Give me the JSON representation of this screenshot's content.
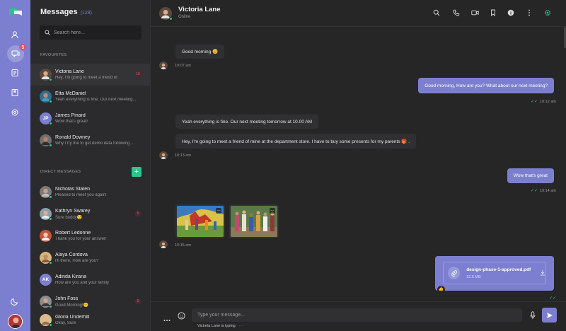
{
  "rail": {
    "nav": [
      "logo-icon",
      "user-icon",
      "chat-icon",
      "contacts-icon",
      "bookmark-icon",
      "settings-icon"
    ],
    "chat_badge": "9",
    "theme_icon": "moon-icon",
    "accent": "#7c7fd0"
  },
  "sidebar": {
    "title": "Messages",
    "count": "(128)",
    "search_placeholder": "Search here...",
    "favourites_label": "FAVOURITES",
    "direct_label": "DIRECT MESSAGES",
    "add_label": "+",
    "favourites": [
      {
        "name": "Victoria Lane",
        "message": "Hey, I'm going to meet a friend of",
        "unread": "18",
        "online": true,
        "active": true
      },
      {
        "name": "Etta McDaniel",
        "message": "Yeah everything is fine. Our next meeting...",
        "online": true
      },
      {
        "name": "James Pinard",
        "initials": "JP",
        "message": "Wow that's great!",
        "online": true
      },
      {
        "name": "Ronald Downey",
        "message": "Why I try the to get demo data following ...",
        "online": true
      }
    ],
    "direct": [
      {
        "name": "Nicholas Staten",
        "message": "Pleased to meet you again!",
        "online": true
      },
      {
        "name": "Kathryn Swarey",
        "message": "Sure buddy😉",
        "unread": "5",
        "online": true
      },
      {
        "name": "Robert Ledonne",
        "message": "Thank you for your answer!"
      },
      {
        "name": "Alaya Cordova",
        "message": "Hi there, How are you?",
        "online": true
      },
      {
        "name": "Adinda Kirana",
        "initials": "AK",
        "message": "How are you and your family"
      },
      {
        "name": "John Foss",
        "message": "Good Morning!🙂",
        "unread": "5",
        "online": true
      },
      {
        "name": "Gloria Underhill",
        "message": "Okay, Sure",
        "online": true
      }
    ]
  },
  "chat": {
    "contact_name": "Victoria Lane",
    "contact_status": "Online",
    "toolbar_icons": [
      "search-icon",
      "call-icon",
      "video-icon",
      "bookmark-icon",
      "info-icon",
      "more-icon",
      "settings-icon"
    ],
    "messages": [
      {
        "dir": "in",
        "text": "Good morning 😊",
        "time": "10:07 am"
      },
      {
        "dir": "out",
        "text": "Good morning, How are you? What about our next meeting?",
        "time": "10:12 am"
      },
      {
        "dir": "in",
        "text": "Yeah everything is fine. Our next meeting tomorrow at 10.00 AM",
        "time": ""
      },
      {
        "dir": "in",
        "text": "Hey, I'm going to meet a friend of mine at the department store. I have to buy some presents for my parents 🎁 .",
        "time": "10:13 am"
      },
      {
        "dir": "out",
        "text": "Wow that's great",
        "time": "10:14 am"
      },
      {
        "dir": "in",
        "type": "images",
        "time": "10:15 am"
      }
    ],
    "file": {
      "name": "design-phase-1-approved.pdf",
      "size": "12.5 MB",
      "reaction": "👍"
    },
    "composer": {
      "placeholder": "Type your message...",
      "typing": "Victoria Lane is typing"
    }
  }
}
